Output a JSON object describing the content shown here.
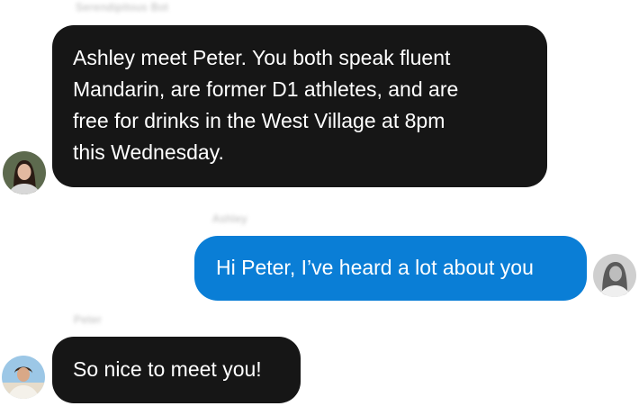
{
  "messages": [
    {
      "sender": "Serendipitous Bot",
      "text": "Ashley meet Peter. You both speak fluent\nMandarin,  are former D1 athletes, and are\nfree for drinks in the West Village at 8pm\nthis Wednesday.",
      "style": "dark",
      "avatar": "woman-avatar"
    },
    {
      "sender": "Ashley",
      "text": "Hi Peter, I’ve heard a lot about you",
      "style": "blue",
      "avatar": "grayscale-woman-avatar"
    },
    {
      "sender": "Peter",
      "text": "So nice to meet you!",
      "style": "dark",
      "avatar": "man-avatar"
    }
  ],
  "colors": {
    "dark_bubble": "#161616",
    "blue_bubble": "#0a7ed6",
    "bubble_text": "#ffffff",
    "sender_name": "#a9a9a9"
  }
}
